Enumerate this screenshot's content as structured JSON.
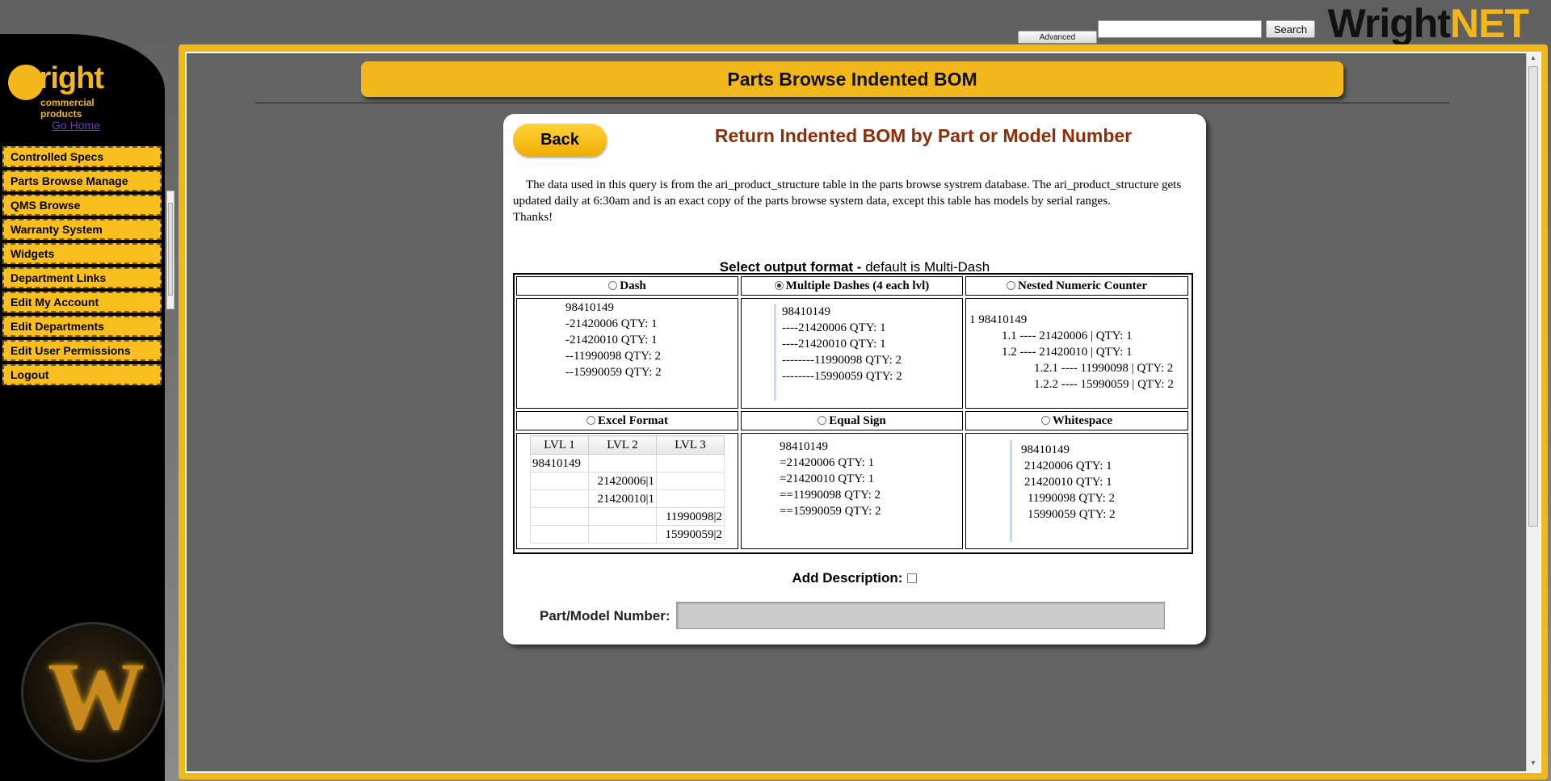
{
  "header": {
    "brand_part1": "Wright",
    "brand_part2": "NET",
    "advanced_label": "Advanced",
    "search_label": "Search",
    "search_value": ""
  },
  "sidebar": {
    "logo_text": "wright",
    "logo_sub": "commercial products",
    "go_home": "Go Home",
    "items": [
      {
        "label": "Controlled Specs"
      },
      {
        "label": "Parts Browse Manage"
      },
      {
        "label": "QMS Browse"
      },
      {
        "label": "Warranty System"
      },
      {
        "label": "Widgets"
      },
      {
        "label": "Department Links"
      },
      {
        "label": "Edit My Account"
      },
      {
        "label": "Edit Departments"
      },
      {
        "label": "Edit User Permissions"
      },
      {
        "label": "Logout"
      }
    ]
  },
  "main": {
    "page_title": "Parts Browse Indented BOM",
    "back_label": "Back",
    "card_heading": "Return Indented BOM by Part or Model Number",
    "intro_line": "The data used in this query is from the ari_product_structure table in the parts browse systrem database. The ari_product_structure gets updated daily at 6:30am and is an exact copy of the parts browse system data, except this table has models by serial ranges.",
    "intro_thanks": "Thanks!",
    "format_heading_bold": "Select output format -",
    "format_heading_rest": " default is Multi-Dash",
    "formats": {
      "dash": {
        "label": "Dash",
        "lines": [
          "98410149",
          "-21420006 QTY: 1",
          "-21420010 QTY: 1",
          "--11990098 QTY: 2",
          "--15990059 QTY: 2"
        ]
      },
      "multi": {
        "label": "Multiple Dashes (4 each lvl)",
        "lines": [
          "98410149",
          "----21420006 QTY: 1",
          "----21420010 QTY: 1",
          "--------11990098 QTY: 2",
          "--------15990059 QTY: 2"
        ]
      },
      "nested": {
        "label": "Nested Numeric Counter",
        "lines": [
          "1 98410149",
          "1.1 ---- 21420006 | QTY: 1",
          "1.2 ---- 21420010 | QTY: 1",
          "1.2.1 ---- 11990098 | QTY: 2",
          "1.2.2 ---- 15990059 | QTY: 2"
        ]
      },
      "excel": {
        "label": "Excel Format",
        "headers": [
          "LVL 1",
          "LVL 2",
          "LVL 3"
        ],
        "r1c1": "98410149",
        "r2c2": "21420006|1",
        "r3c2": "21420010|1",
        "r4c3": "11990098|2",
        "r5c3": "15990059|2"
      },
      "equal": {
        "label": "Equal Sign",
        "lines": [
          "98410149",
          "=21420006 QTY: 1",
          "=21420010 QTY: 1",
          "==11990098 QTY: 2",
          "==15990059 QTY: 2"
        ]
      },
      "whitespace": {
        "label": "Whitespace",
        "lines": [
          "98410149",
          "21420006 QTY: 1",
          "21420010 QTY: 1",
          "11990098 QTY: 2",
          "15990059 QTY: 2"
        ]
      }
    },
    "selected_format": "multi",
    "add_description_label": "Add Description:",
    "part_number_label": "Part/Model Number:",
    "part_number_value": ""
  },
  "colors": {
    "accent": "#f2b71a",
    "heading": "#8b2e0a",
    "frame_bg": "#646464"
  }
}
